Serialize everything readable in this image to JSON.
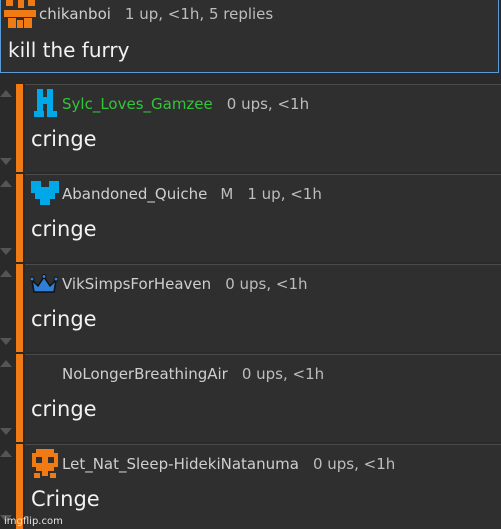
{
  "top_comment": {
    "username": "chikanboi",
    "stats": "1 up, <1h, 5 replies",
    "text": "kill the furry",
    "avatar_color": "#f07a14"
  },
  "replies": [
    {
      "username": "Sylc_Loves_Gamzee",
      "badge": "",
      "stats": "0 ups, <1h",
      "text": "cringe",
      "name_color": "#34c43a",
      "avatar": "blue-figure-icon"
    },
    {
      "username": "Abandoned_Quiche",
      "badge": "M",
      "stats": "1 up, <1h",
      "text": "cringe",
      "name_color": "#cfcfcf",
      "avatar": "blue-heart-icon"
    },
    {
      "username": "VikSimpsForHeaven",
      "badge": "",
      "stats": "0 ups, <1h",
      "text": "cringe",
      "name_color": "#cfcfcf",
      "avatar": "crown-icon"
    },
    {
      "username": "NoLongerBreathingAir",
      "badge": "",
      "stats": "0 ups, <1h",
      "text": "cringe",
      "name_color": "#cfcfcf",
      "avatar": "none"
    },
    {
      "username": "Let_Nat_Sleep-HidekiNatanuma",
      "badge": "",
      "stats": "0 ups, <1h",
      "text": "Cringe",
      "name_color": "#cfcfcf",
      "avatar": "orange-skull-icon"
    }
  ],
  "watermark": "imgflip.com",
  "colors": {
    "accent": "#f07a14",
    "highlight_border": "#5a9bd5",
    "green_user": "#34c43a"
  }
}
